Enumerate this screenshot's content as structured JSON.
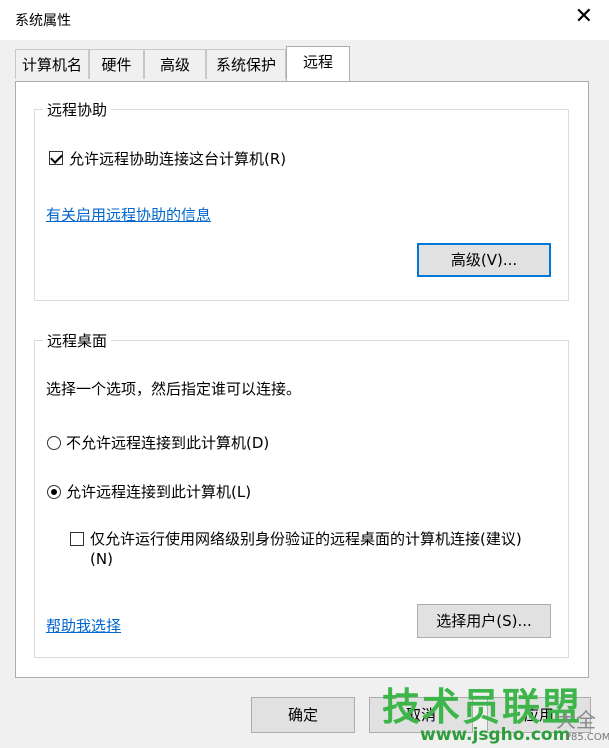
{
  "window": {
    "title": "系统属性",
    "close_symbol": "✕"
  },
  "tabs": [
    {
      "label": "计算机名",
      "active": false
    },
    {
      "label": "硬件",
      "active": false
    },
    {
      "label": "高级",
      "active": false
    },
    {
      "label": "系统保护",
      "active": false
    },
    {
      "label": "远程",
      "active": true
    }
  ],
  "remote_assistance": {
    "title": "远程协助",
    "allow_checkbox": {
      "label": "允许远程协助连接这台计算机(R)",
      "checked": true
    },
    "info_link": "有关启用远程协助的信息",
    "advanced_button": "高级(V)..."
  },
  "remote_desktop": {
    "title": "远程桌面",
    "instruction": "选择一个选项，然后指定谁可以连接。",
    "radio_disallow": {
      "label": "不允许远程连接到此计算机(D)",
      "checked": false
    },
    "radio_allow": {
      "label": "允许远程连接到此计算机(L)",
      "checked": true
    },
    "nla_checkbox": {
      "label_line1": "仅允许运行使用网络级别身份验证的远程桌面的计算机连接(建议)",
      "label_line2": "(N)",
      "checked": false
    },
    "help_link": "帮助我选择",
    "select_users_button": "选择用户(S)..."
  },
  "footer": {
    "ok_button": "确定",
    "cancel_button": "取消",
    "apply_button": "应用"
  },
  "watermark": {
    "main": "技术员联盟",
    "tail": "大全",
    "url": "www.jsgho.com",
    "tag": "P85.COM"
  },
  "colors": {
    "link": "#0066cc",
    "focus_border": "#0078d7",
    "watermark_green": "#3db54a"
  }
}
